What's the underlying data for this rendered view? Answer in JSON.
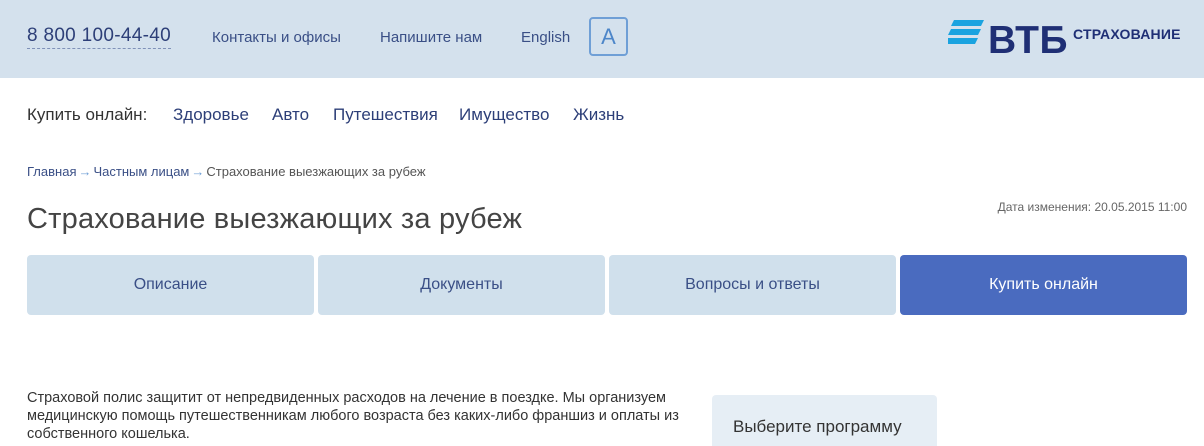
{
  "header": {
    "phone": "8 800 100-44-40",
    "links": [
      {
        "label": "Контакты и офисы"
      },
      {
        "label": "Напишите нам"
      },
      {
        "label": "English"
      }
    ],
    "accessibility_label": "A",
    "logo": {
      "brand": "ВТБ",
      "sub": "СТРАХОВАНИЕ",
      "color": "#1f2f75"
    }
  },
  "buy_online": {
    "label": "Купить онлайн:",
    "items": [
      {
        "label": "Здоровье"
      },
      {
        "label": "Авто"
      },
      {
        "label": "Путешествия"
      },
      {
        "label": "Имущество"
      },
      {
        "label": "Жизнь"
      }
    ]
  },
  "breadcrumb": {
    "items": [
      {
        "label": "Главная"
      },
      {
        "label": "Частным лицам"
      },
      {
        "label": "Страхование выезжающих за рубеж"
      }
    ]
  },
  "page": {
    "title": "Страхование выезжающих за рубеж",
    "modified": "Дата изменения: 20.05.2015 11:00"
  },
  "tabs": [
    {
      "label": "Описание",
      "active": false
    },
    {
      "label": "Документы",
      "active": false
    },
    {
      "label": "Вопросы и ответы",
      "active": false
    },
    {
      "label": "Купить онлайн",
      "active": true
    }
  ],
  "content": {
    "description": "Страховой полис защитит от непредвиденных расходов на лечение в поездке. Мы организуем медицинскую помощь путешественникам любого возраста без каких-либо франшиз и оплаты из собственного кошелька."
  },
  "program_box": {
    "label": "Выберите программу"
  },
  "colors": {
    "topbar_bg": "#d4e1ed",
    "tab_bg": "#d0e0ec",
    "tab_active_bg": "#4a6bbf",
    "link": "#2d3f78",
    "accent_blue": "#4d86c9"
  }
}
